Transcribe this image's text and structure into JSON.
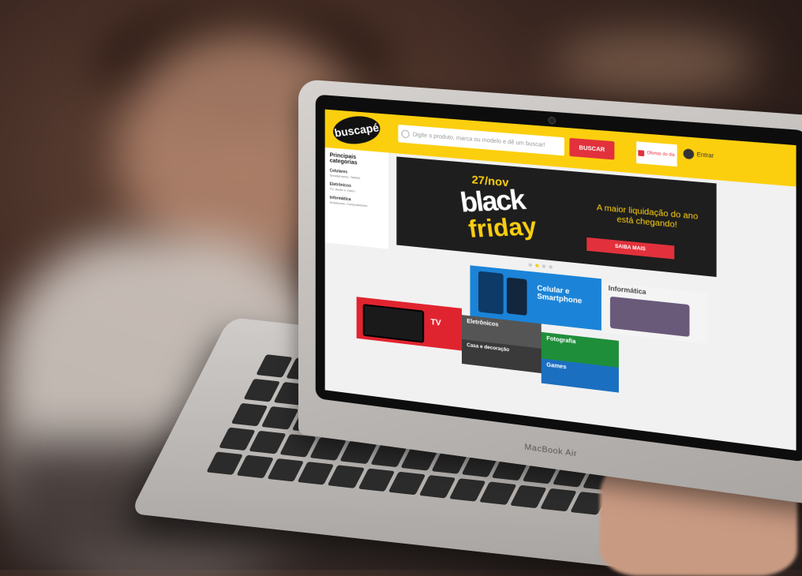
{
  "site": {
    "logo_text": "buscapé",
    "search_placeholder": "Digite o produto, marca ou modelo e dê um buscar!",
    "search_button": "BUSCAR",
    "offer_label": "Ofertas do dia",
    "user_label": "Entrar"
  },
  "sidebar": {
    "title": "Principais categorias",
    "items": [
      {
        "label": "Celulares",
        "sub": "Smartphones, Tablets"
      },
      {
        "label": "Eletrônicos",
        "sub": "TV, Áudio e Vídeo"
      },
      {
        "label": "Informática",
        "sub": "Notebooks, Computadores"
      }
    ]
  },
  "banner": {
    "date": "27/nov",
    "word1": "black",
    "word2": "friday",
    "tagline": "A maior liquidação do ano está chegando!",
    "cta": "SAIBA MAIS"
  },
  "tiles": {
    "celular": "Celular e Smartphone",
    "info": "Informática",
    "tv": "TV",
    "eletro": "Eletrônicos",
    "casa": "Casa e decoração",
    "foto": "Fotografia",
    "games": "Games"
  },
  "laptop": {
    "brand": "MacBook Air"
  }
}
